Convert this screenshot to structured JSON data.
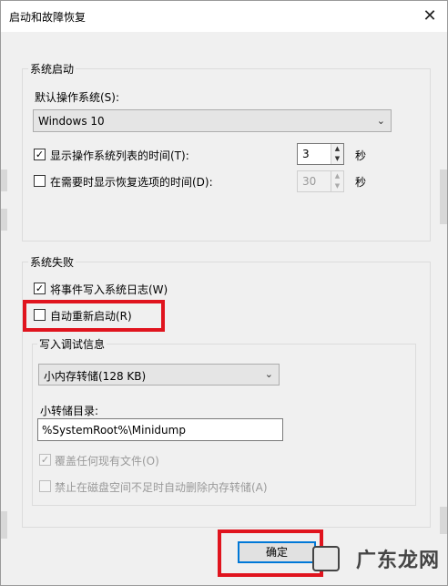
{
  "window": {
    "title": "启动和故障恢复"
  },
  "system_startup": {
    "group_title": "系统启动",
    "default_os_label": "默认操作系统(S):",
    "default_os_value": "Windows 10",
    "show_os_list": {
      "checked": true,
      "label": "显示操作系统列表的时间(T):",
      "value": "3",
      "unit": "秒"
    },
    "show_recovery": {
      "checked": false,
      "label": "在需要时显示恢复选项的时间(D):",
      "value": "30",
      "unit": "秒"
    }
  },
  "system_failure": {
    "group_title": "系统失败",
    "write_event_log": {
      "checked": true,
      "label": "将事件写入系统日志(W)"
    },
    "auto_restart": {
      "checked": false,
      "label": "自动重新启动(R)"
    },
    "debug_info": {
      "group_title": "写入调试信息",
      "dump_type": "小内存转储(128 KB)",
      "dump_dir_label": "小转储目录:",
      "dump_dir_value": "%SystemRoot%\\Minidump",
      "overwrite": {
        "checked": true,
        "label": "覆盖任何现有文件(O)"
      },
      "disable_auto_delete": {
        "checked": false,
        "label": "禁止在磁盘空间不足时自动删除内存转储(A)"
      }
    }
  },
  "buttons": {
    "ok": "确定"
  },
  "watermark": {
    "text": "广东龙网"
  }
}
